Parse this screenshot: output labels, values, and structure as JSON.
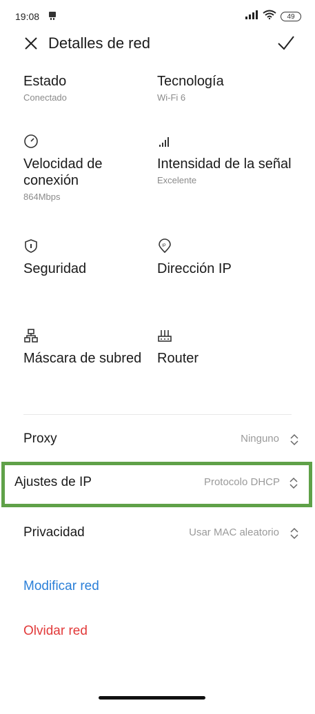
{
  "status": {
    "time": "19:08",
    "battery": "49"
  },
  "header": {
    "title": "Detalles de red"
  },
  "grid": [
    {
      "label": "Estado",
      "sub": "Conectado",
      "icon": ""
    },
    {
      "label": "Tecnología",
      "sub": "Wi-Fi 6",
      "icon": ""
    },
    {
      "label": "Velocidad de conexión",
      "sub": "864Mbps",
      "icon": "speedometer-icon"
    },
    {
      "label": "Intensidad de la señal",
      "sub": "Excelente",
      "icon": "signal-bars-icon"
    },
    {
      "label": "Seguridad",
      "sub": "",
      "icon": "shield-icon"
    },
    {
      "label": "Dirección IP",
      "sub": "",
      "icon": "ip-pin-icon"
    },
    {
      "label": "Máscara de subred",
      "sub": "",
      "icon": "network-tree-icon"
    },
    {
      "label": "Router",
      "sub": "",
      "icon": "router-icon"
    }
  ],
  "rows": [
    {
      "label": "Proxy",
      "value": "Ninguno"
    },
    {
      "label": "Ajustes de IP",
      "value": "Protocolo DHCP"
    },
    {
      "label": "Privacidad",
      "value": "Usar MAC aleatorio"
    }
  ],
  "actions": {
    "modify": "Modificar red",
    "forget": "Olvidar red"
  },
  "colors": {
    "highlight": "#5fa148",
    "link_blue": "#2a7fd8",
    "danger_red": "#e23a3a"
  }
}
